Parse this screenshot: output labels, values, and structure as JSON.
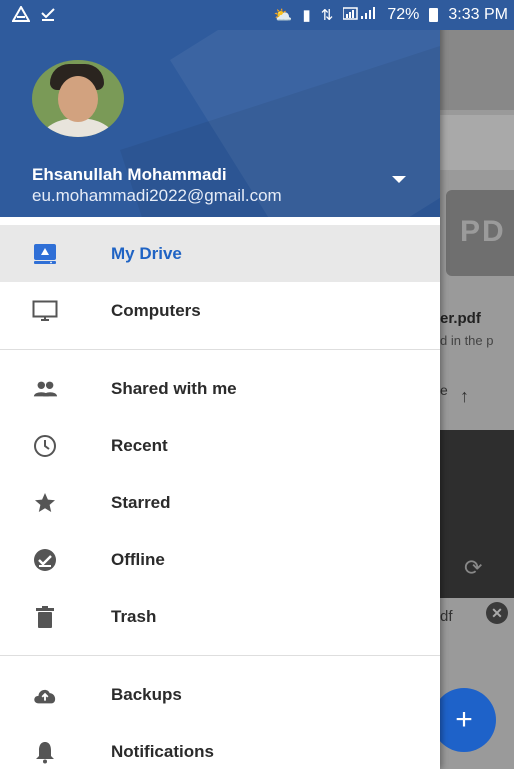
{
  "status_bar": {
    "battery": "72%",
    "time": "3:33 PM"
  },
  "account": {
    "name": "Ehsanullah Mohammadi",
    "email": "eu.mohammadi2022@gmail.com"
  },
  "menu": {
    "group1": [
      {
        "label": "My Drive",
        "icon": "drive-icon",
        "active": true
      },
      {
        "label": "Computers",
        "icon": "computer-icon",
        "active": false
      }
    ],
    "group2": [
      {
        "label": "Shared with me",
        "icon": "people-icon"
      },
      {
        "label": "Recent",
        "icon": "clock-icon"
      },
      {
        "label": "Starred",
        "icon": "star-icon"
      },
      {
        "label": "Offline",
        "icon": "offline-check-icon"
      },
      {
        "label": "Trash",
        "icon": "trash-icon"
      }
    ],
    "group3": [
      {
        "label": "Backups",
        "icon": "cloud-backup-icon"
      },
      {
        "label": "Notifications",
        "icon": "bell-icon"
      }
    ]
  },
  "background": {
    "thumb_text": "PD",
    "file_name": "er.pdf",
    "file_sub": "d in the p",
    "sort_label": "e",
    "file2": "df"
  },
  "colors": {
    "header_blue": "#2f5b9d",
    "accent_blue": "#1f63c4",
    "fab_blue": "#1e62c9"
  }
}
